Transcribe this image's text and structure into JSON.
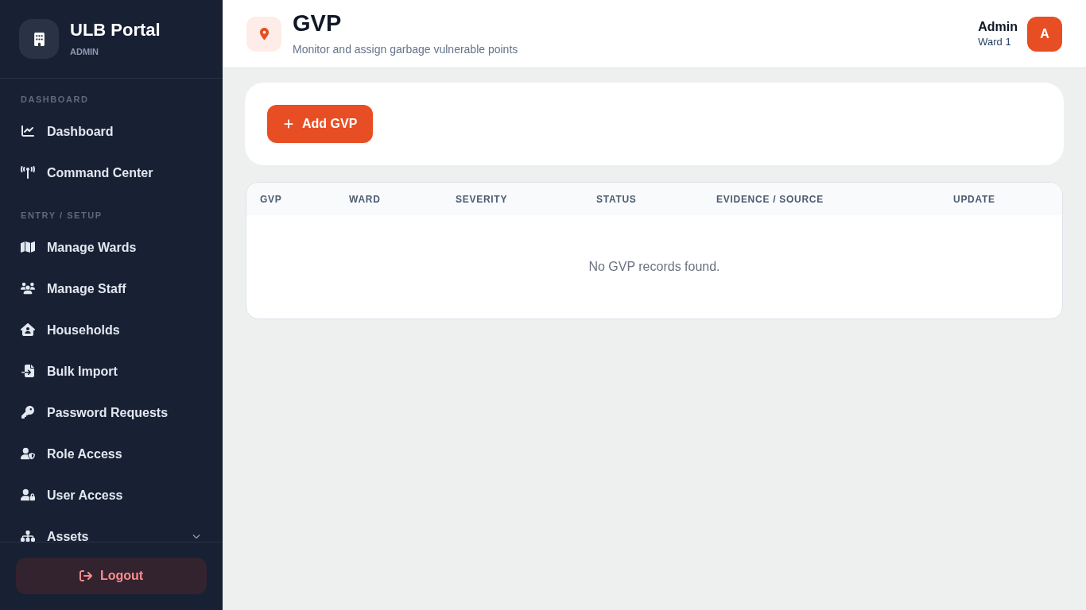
{
  "sidebar": {
    "brand": {
      "title": "ULB Portal",
      "subtitle": "ADMIN"
    },
    "sections": [
      {
        "label": "DASHBOARD",
        "items": [
          {
            "label": "Dashboard",
            "selected": false
          },
          {
            "label": "Command Center",
            "selected": false
          }
        ]
      },
      {
        "label": "ENTRY / SETUP",
        "items": [
          {
            "label": "Manage Wards",
            "selected": false
          },
          {
            "label": "Manage Staff",
            "selected": false
          },
          {
            "label": "Households",
            "selected": false
          },
          {
            "label": "Bulk Import",
            "selected": false
          },
          {
            "label": "Password Requests",
            "selected": false
          },
          {
            "label": "Role Access",
            "selected": false
          },
          {
            "label": "User Access",
            "selected": false
          },
          {
            "label": "Assets",
            "selected": false,
            "expanded": false
          }
        ]
      }
    ],
    "logout": "Logout"
  },
  "header": {
    "title": "GVP",
    "subtitle": "Monitor and assign garbage vulnerable points",
    "user": {
      "name": "Admin",
      "ward": "Ward 1",
      "avatar": "A"
    }
  },
  "toolbar": {
    "add_button": "Add GVP"
  },
  "table": {
    "columns": [
      "GVP",
      "WARD",
      "SEVERITY",
      "STATUS",
      "EVIDENCE / SOURCE",
      "UPDATE"
    ],
    "empty_message": "No GVP records found."
  }
}
